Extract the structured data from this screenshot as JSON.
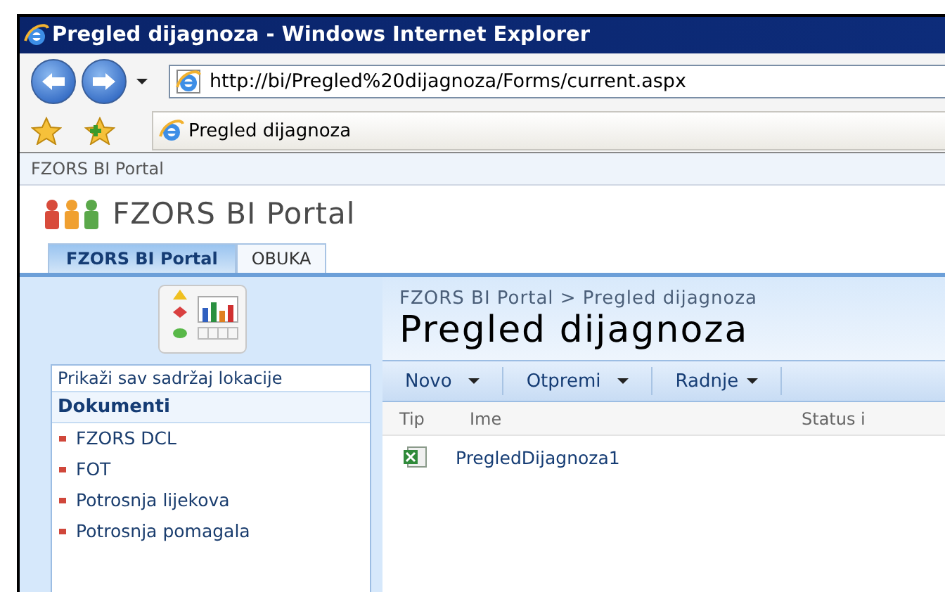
{
  "window": {
    "title": "Pregled dijagnoza - Windows Internet Explorer"
  },
  "address_bar": {
    "value": "http://bi/Pregled%20dijagnoza/Forms/current.aspx"
  },
  "browser_tab": {
    "label": "Pregled dijagnoza"
  },
  "site_path": "FZORS BI Portal",
  "site_title": "FZORS BI Portal",
  "tabs": [
    {
      "label": "FZORS BI Portal",
      "selected": true
    },
    {
      "label": "OBUKA",
      "selected": false
    }
  ],
  "sidebar": {
    "view_all": "Prikaži sav sadržaj lokacije",
    "section": "Dokumenti",
    "items": [
      {
        "label": "FZORS DCL"
      },
      {
        "label": "FOT"
      },
      {
        "label": "Potrosnja lijekova"
      },
      {
        "label": "Potrosnja pomagala"
      }
    ]
  },
  "breadcrumb": "FZORS BI Portal > Pregled dijagnoza",
  "page_title": "Pregled dijagnoza",
  "toolbar": [
    {
      "label": "Novo"
    },
    {
      "label": "Otpremi"
    },
    {
      "label": "Radnje"
    }
  ],
  "table": {
    "columns": [
      "Tip",
      "Ime",
      "Status i"
    ],
    "rows": [
      {
        "name": "PregledDijagnoza1"
      }
    ]
  }
}
